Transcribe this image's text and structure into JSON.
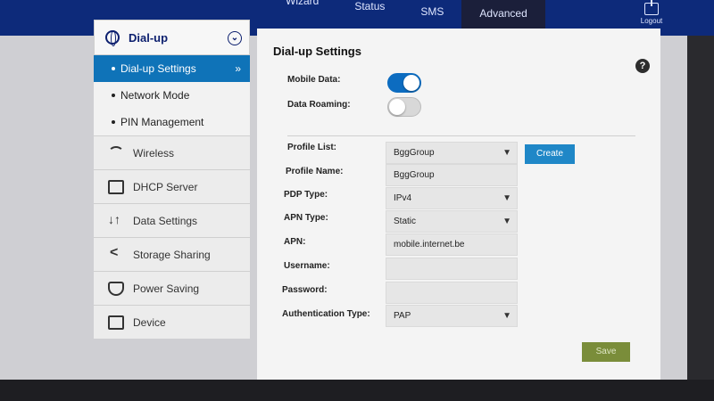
{
  "topnav": {
    "tabs": [
      {
        "label": "Wizard"
      },
      {
        "label": "Status"
      },
      {
        "label": "SMS"
      },
      {
        "label": "Advanced"
      }
    ],
    "logout_label": "Logout"
  },
  "sidebar": {
    "header": "Dial-up",
    "subitems": [
      {
        "label": "Dial-up Settings"
      },
      {
        "label": "Network Mode"
      },
      {
        "label": "PIN Management"
      }
    ],
    "menu": [
      {
        "label": "Wireless"
      },
      {
        "label": "DHCP Server"
      },
      {
        "label": "Data Settings"
      },
      {
        "label": "Storage Sharing"
      },
      {
        "label": "Power Saving"
      },
      {
        "label": "Device"
      }
    ]
  },
  "main": {
    "title": "Dial-up Settings",
    "mobile_data_label": "Mobile Data:",
    "mobile_data_on": true,
    "data_roaming_label": "Data Roaming:",
    "data_roaming_on": false,
    "profile_list_label": "Profile List:",
    "profile_list_value": "BggGroup",
    "create_label": "Create",
    "profile_name_label": "Profile Name:",
    "profile_name_value": "BggGroup",
    "pdp_type_label": "PDP Type:",
    "pdp_type_value": "IPv4",
    "apn_type_label": "APN Type:",
    "apn_type_value": "Static",
    "apn_label": "APN:",
    "apn_value": "mobile.internet.be",
    "username_label": "Username:",
    "username_value": "",
    "password_label": "Password:",
    "password_value": "",
    "auth_type_label": "Authentication Type:",
    "auth_type_value": "PAP",
    "save_label": "Save"
  },
  "colors": {
    "topbar": "#0d2a7a",
    "active_item": "#0f73b8",
    "create_button": "#1f87c7",
    "save_button": "#7a8d3a"
  }
}
